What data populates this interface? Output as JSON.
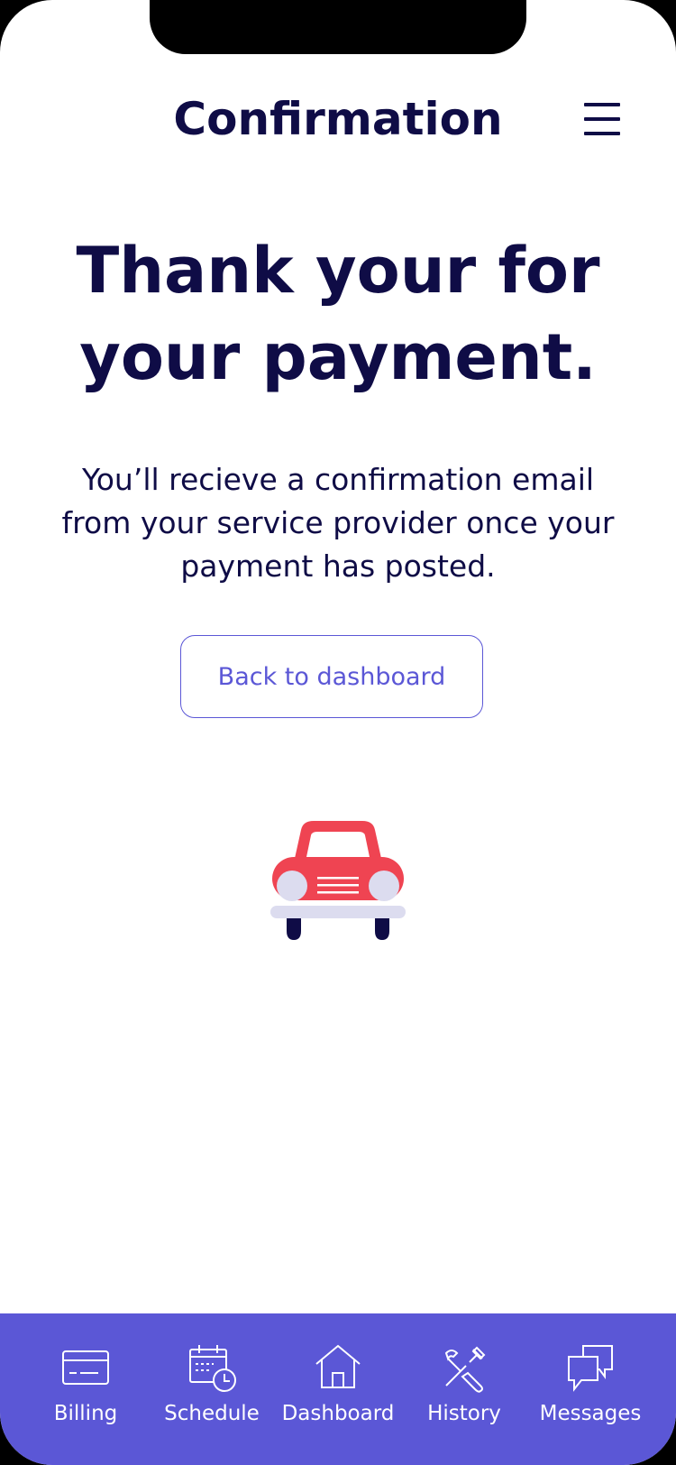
{
  "header": {
    "title": "Confirmation",
    "menu_icon": "hamburger-menu-icon"
  },
  "main": {
    "headline": "Thank your for your payment.",
    "message": "You’ll recieve a confirmation email from your service provider once your payment has posted.",
    "back_button_label": "Back to dashboard",
    "illustration": "car-icon"
  },
  "tabbar": {
    "tabs": [
      {
        "label": "Billing",
        "icon": "credit-card-icon"
      },
      {
        "label": "Schedule",
        "icon": "calendar-clock-icon"
      },
      {
        "label": "Dashboard",
        "icon": "home-icon"
      },
      {
        "label": "History",
        "icon": "tools-icon"
      },
      {
        "label": "Messages",
        "icon": "chat-bubbles-icon"
      }
    ]
  },
  "colors": {
    "primary_text": "#0f0c46",
    "accent": "#5b57d6",
    "car_body": "#ef4452",
    "car_light": "#dcdcef"
  }
}
